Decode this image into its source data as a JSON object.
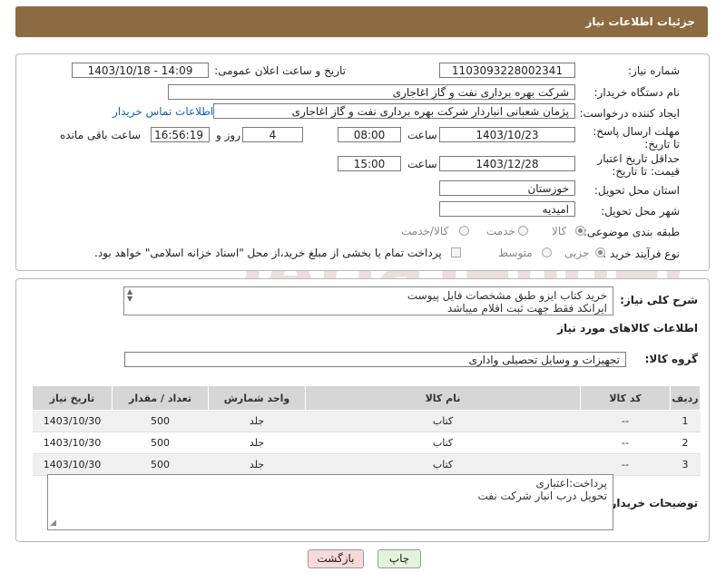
{
  "page_title": "جزئیات اطلاعات نیاز",
  "fields": {
    "need_number_label": "شماره نیاز:",
    "need_number": "1103093228002341",
    "announce_label": "تاریخ و ساعت اعلان عمومی:",
    "announce_value": "1403/10/18 - 14:09",
    "buyer_label": "نام دستگاه خریدار:",
    "buyer_value": "شرکت بهره برداری نفت و گاز اغاجاری",
    "creator_label": "ایجاد کننده درخواست:",
    "creator_value": "پژمان شعبانی انباردار شرکت بهره برداری نفت و گاز اغاجاری",
    "contact_link": "اطلاعات تماس خریدار",
    "reply_deadline_label": "مهلت ارسال پاسخ: تا تاریخ:",
    "reply_date": "1403/10/23",
    "time_label": "ساعت",
    "reply_time": "08:00",
    "days_value": "4",
    "days_label": "روز و",
    "remaining_time": "16:56:19",
    "remaining_label": "ساعت باقی مانده",
    "price_deadline_label": "حداقل تاریخ اعتبار قیمت: تا تاریخ:",
    "price_date": "1403/12/28",
    "price_time": "15:00",
    "province_label": "استان محل تحویل:",
    "province_value": "خوزستان",
    "city_label": "شهر محل تحویل:",
    "city_value": "امیدیه",
    "category_label": "طبقه بندی موضوعی:",
    "category_opt1": "کالا",
    "category_opt2": "خدمت",
    "category_opt3": "کالا/خدمت",
    "process_label": "نوع فرآیند خرید :",
    "process_opt1": "جزیی",
    "process_opt2": "متوسط",
    "process_note": "پرداخت تمام یا بخشی از مبلغ خرید،از محل \"اسناد خزانه اسلامی\" خواهد بود."
  },
  "description": {
    "label": "شرح کلی نیاز:",
    "line1": "خرید کتاب ایزو طبق مشخصات فایل پیوست",
    "line2": "ایرانکد فقط جهت ثبت اقلام میباشد"
  },
  "goods": {
    "section_title": "اطلاعات کالاهای مورد نیاز",
    "group_label": "گروه کالا:",
    "group_value": "تجهیزات و وسایل تحصیلی واداری",
    "headers": [
      "ردیف",
      "کد کالا",
      "نام کالا",
      "واحد شمارش",
      "تعداد / مقدار",
      "تاریخ نیاز"
    ],
    "rows": [
      [
        "1",
        "--",
        "کتاب",
        "جلد",
        "500",
        "1403/10/30"
      ],
      [
        "2",
        "--",
        "کتاب",
        "جلد",
        "500",
        "1403/10/30"
      ],
      [
        "3",
        "--",
        "کتاب",
        "جلد",
        "500",
        "1403/10/30"
      ]
    ]
  },
  "buyer_notes": {
    "label": "توضیحات خریدار:",
    "line1": "پرداخت:اعتباری",
    "line2": "تحویل درب انبار شرکت نفت"
  },
  "buttons": {
    "print": "چاپ",
    "back": "بازگشت"
  },
  "watermark_text": "AriaTender.neT",
  "colors": {
    "title_bar": "#8b6b3f",
    "link": "#1a5fb4",
    "back_button": "#f7d9d9",
    "print_button": "#e2f3dc"
  }
}
